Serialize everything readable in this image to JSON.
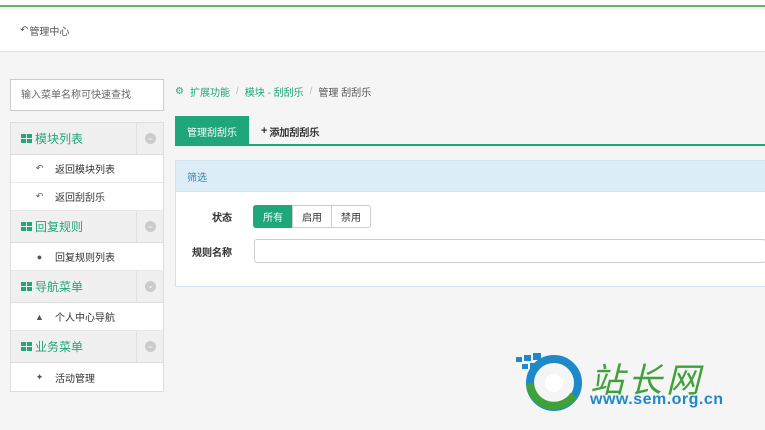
{
  "header": {
    "back_label": "管理中心"
  },
  "sidebar": {
    "search_placeholder": "输入菜单名称可快速查找",
    "groups": [
      {
        "title": "模块列表",
        "items": [
          {
            "label": "返回模块列表",
            "icon": "reply-icon"
          },
          {
            "label": "返回刮刮乐",
            "icon": "reply-icon"
          }
        ]
      },
      {
        "title": "回复规则",
        "items": [
          {
            "label": "回复规则列表",
            "icon": "comments-icon"
          }
        ]
      },
      {
        "title": "导航菜单",
        "items": [
          {
            "label": "个人中心导航",
            "icon": "user-icon"
          }
        ]
      },
      {
        "title": "业务菜单",
        "items": [
          {
            "label": "活动管理",
            "icon": "activity-icon"
          }
        ]
      }
    ]
  },
  "breadcrumb": {
    "items": [
      "扩展功能",
      "模块 - 刮刮乐"
    ],
    "current": "管理 刮刮乐"
  },
  "tabs": {
    "manage": "管理刮刮乐",
    "add": "添加刮刮乐"
  },
  "filter": {
    "title": "筛选",
    "status_label": "状态",
    "status_options": [
      "所有",
      "启用",
      "禁用"
    ],
    "selected_status": "所有",
    "name_label": "规则名称",
    "name_value": ""
  },
  "watermark": {
    "logo_text": "站长网",
    "url": "www.sem.org.cn"
  },
  "colors": {
    "accent": "#1fa67a",
    "panel_head": "#dcedf7",
    "info_text": "#3a87ad"
  }
}
